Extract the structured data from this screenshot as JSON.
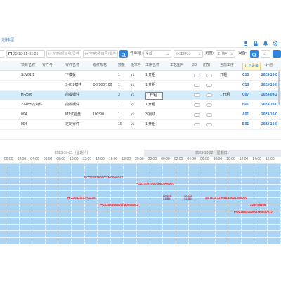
{
  "header": {
    "tab_label": "划排程",
    "icons": [
      "user-icon",
      "lock-icon",
      "bell-icon",
      "settings-icon"
    ]
  },
  "toolbar": {
    "date_range": "23-10-21~11-21",
    "search_placeholder": "(+,空格)项目名/零件",
    "search2_placeholder": "(+,空格)项目号/零件",
    "area_label": "作业组:",
    "area_value": "全部",
    "process_value": "<<工序>>",
    "scale_label": "刻度:",
    "scale_value": "2分钟",
    "device_label": "设备:"
  },
  "table": {
    "headers": [
      "项目名称",
      "零件号",
      "零件名称",
      "零件规格",
      "数量",
      "版本号",
      "工序名称",
      "工艺图片",
      "2D",
      "附加",
      "当前工序",
      "计划设备",
      "计划"
    ],
    "rows": [
      {
        "project": "SJV01-1",
        "part_no": "",
        "part_name": "下模板",
        "spec": "",
        "qty": "1",
        "ver": "v1",
        "process": "1 开粗",
        "current": "开粗",
        "device": "C10",
        "plan": "2023-10-0"
      },
      {
        "project": "",
        "part_no": "",
        "part_name": "S-812模柱",
        "spec": "Φ8*500*100",
        "qty": "1",
        "ver": "v1",
        "process": "1 开粗",
        "current": "",
        "device": "C10",
        "plan": "2023-10-0"
      },
      {
        "project": "H-2305",
        "part_no": "",
        "part_name": "前模镶件",
        "spec": "",
        "qty": "3",
        "ver": "v1",
        "process": "1 开粗",
        "current": "1 开粗",
        "device": "C07",
        "plan": "2023-09-2"
      },
      {
        "project": "22-055定制件",
        "part_no": "",
        "part_name": "前模镶件",
        "spec": "",
        "qty": "1",
        "ver": "v1",
        "process": "1 开粗",
        "current": "",
        "device": "B01",
        "plan": "2023-10-0"
      },
      {
        "project": "004",
        "part_no": "",
        "part_name": "M1试验盘",
        "spec": "100*90",
        "qty": "1",
        "ver": "v1",
        "process": "3 割线",
        "current": "",
        "device": "A01",
        "plan": "2023-10-0"
      },
      {
        "project": "004",
        "part_no": "",
        "part_name": "定制零件",
        "spec": "",
        "qty": "10",
        "ver": "v1",
        "process": "1 开粗",
        "current": "",
        "device": "B01",
        "plan": "2023-10-0"
      },
      {
        "project": "",
        "part_no": "",
        "part_name": "",
        "spec": "",
        "qty": "",
        "ver": "",
        "process": "",
        "current": "",
        "device": "",
        "plan": ""
      }
    ]
  },
  "gantt": {
    "date1": "2023-10-21（星期六）",
    "date2": "2023-10-22（星期日）",
    "hours": [
      "00:00",
      "02:00",
      "04:00",
      "06:00",
      "08:00",
      "10:00",
      "12:00",
      "14:00",
      "16:00",
      "18:00",
      "20:00",
      "22:00",
      "00:00",
      "02:00",
      "04:00",
      "06:00",
      "08:00",
      "10:00",
      "12:00",
      "14:00",
      "16:00"
    ],
    "labels": [
      {
        "text": "PO2208190001/M0000042"
      },
      {
        "text": "PO2210210001/M0000007"
      },
      {
        "text": "H-23042/03.F01.05"
      },
      {
        "text": "22-022-C1/B01"
      },
      {
        "text": "22-022-C1/B01"
      },
      {
        "text": "2S B01 32208240001/M0000"
      },
      {
        "text": "PO2208190001/M0000043"
      },
      {
        "text": "22975/B05"
      },
      {
        "text": "PO2208200001/M0000017"
      }
    ]
  },
  "colors": {
    "accent": "#2f86dc",
    "gantt_bar": "#a9d4f4",
    "gantt_text": "#d62a2a",
    "selected_row": "#d5ecfb"
  }
}
